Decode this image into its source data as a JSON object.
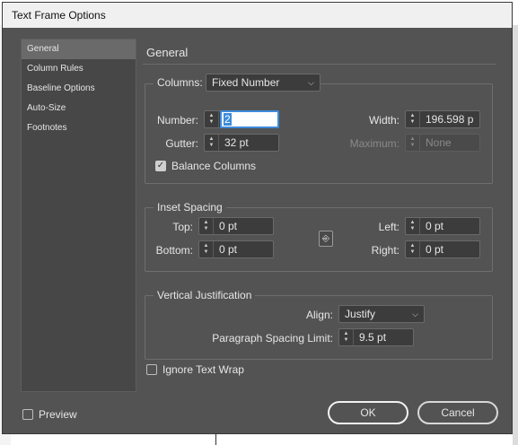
{
  "dialog": {
    "title": "Text Frame Options"
  },
  "sidebar": {
    "items": [
      {
        "label": "General",
        "active": true
      },
      {
        "label": "Column Rules"
      },
      {
        "label": "Baseline Options"
      },
      {
        "label": "Auto-Size"
      },
      {
        "label": "Footnotes"
      }
    ]
  },
  "general": {
    "title": "General",
    "columns": {
      "label": "Columns:",
      "type": "Fixed Number",
      "number_label": "Number:",
      "number_value": "2",
      "gutter_label": "Gutter:",
      "gutter_value": "32 pt",
      "width_label": "Width:",
      "width_value": "196.598 p",
      "maximum_label": "Maximum:",
      "maximum_value": "None",
      "balance_label": "Balance Columns",
      "balance_checked": true
    },
    "inset": {
      "title": "Inset Spacing",
      "top_label": "Top:",
      "top_value": "0 pt",
      "bottom_label": "Bottom:",
      "bottom_value": "0 pt",
      "left_label": "Left:",
      "left_value": "0 pt",
      "right_label": "Right:",
      "right_value": "0 pt"
    },
    "vertical": {
      "title": "Vertical Justification",
      "align_label": "Align:",
      "align_value": "Justify",
      "spacing_label": "Paragraph Spacing Limit:",
      "spacing_value": "9.5 pt"
    },
    "ignore_wrap_label": "Ignore Text Wrap"
  },
  "footer": {
    "preview_label": "Preview",
    "ok_label": "OK",
    "cancel_label": "Cancel"
  }
}
